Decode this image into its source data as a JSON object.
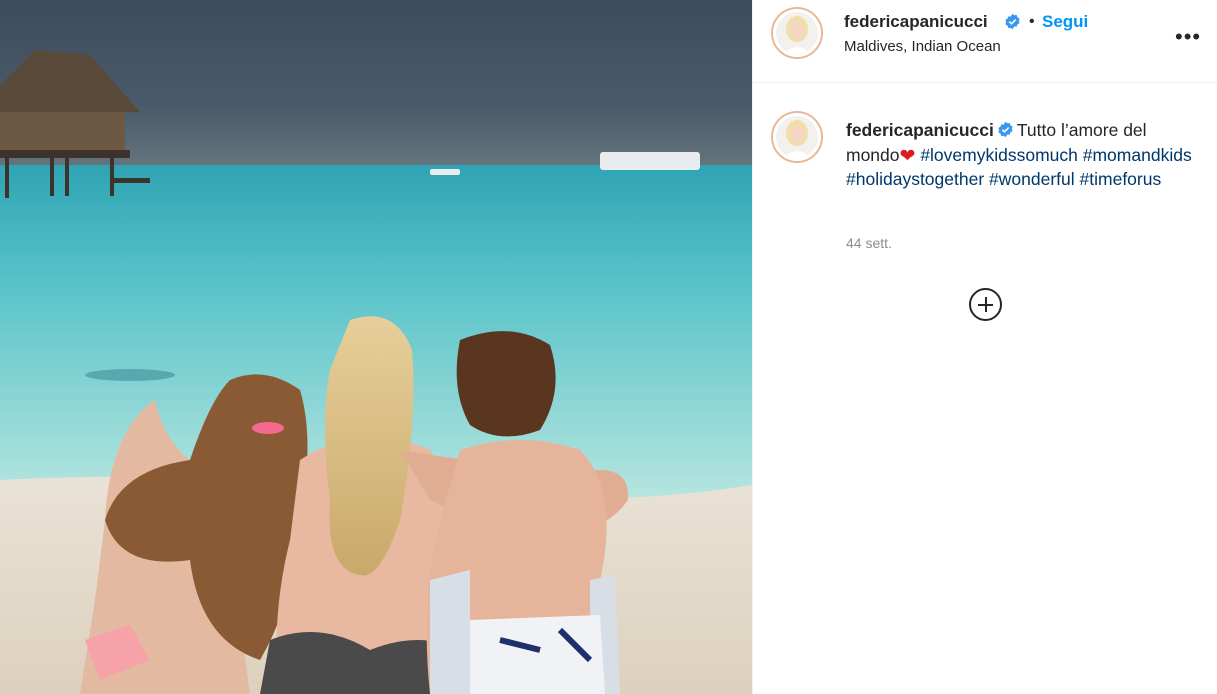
{
  "post": {
    "username": "federicapanicucci",
    "follow_label": "Segui",
    "separator": "•",
    "location": "Maldives, Indian Ocean",
    "more_label": "•••"
  },
  "caption": {
    "username": "federicapanicucci",
    "text": "Tutto l’amore del mondo",
    "heart": "❤",
    "hashtags": [
      "#lovemykidssomuch",
      "#momandkids",
      "#holidaystogether",
      "#wonderful",
      "#timeforus"
    ],
    "time_ago": "44 sett."
  },
  "icons": {
    "verified": "verified-badge-icon",
    "load_more": "circle-plus-icon",
    "more": "more-options-icon"
  },
  "colors": {
    "link_blue": "#0095f6",
    "hashtag": "#00376b",
    "verified": "#3897f0",
    "muted": "#8e8e8e"
  }
}
